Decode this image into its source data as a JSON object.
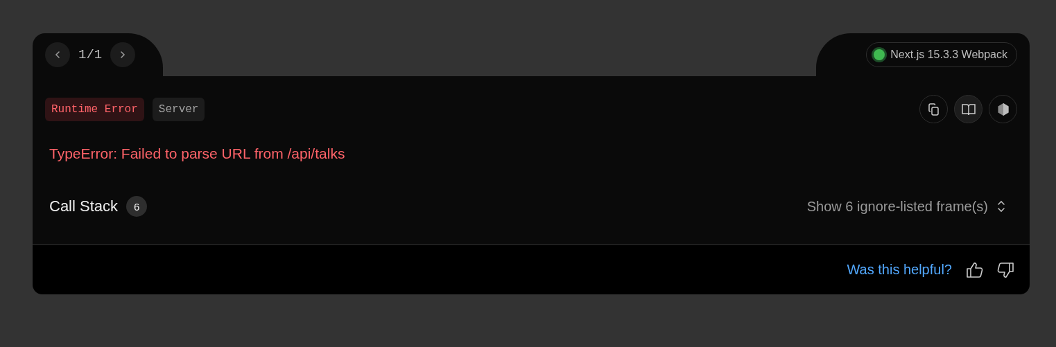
{
  "pager": {
    "label": "1/1"
  },
  "build": {
    "healthy": true,
    "label": "Next.js 15.3.3 Webpack"
  },
  "badges": [
    {
      "label": "Runtime Error",
      "kind": "error"
    },
    {
      "label": "Server",
      "kind": "neutral"
    }
  ],
  "message": "TypeError: Failed to parse URL from /api/talks",
  "call_stack": {
    "title": "Call Stack",
    "count": "6",
    "toggle": "Show 6 ignore-listed frame(s)"
  },
  "footer": {
    "question": "Was this helpful?"
  }
}
